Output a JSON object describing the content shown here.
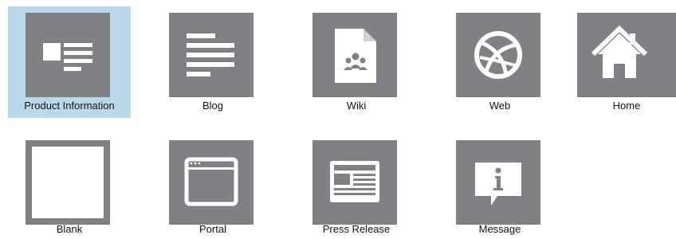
{
  "templates": [
    {
      "label": "Product Information",
      "icon": "product-information-icon",
      "selected": true
    },
    {
      "label": "Blog",
      "icon": "blog-icon",
      "selected": false
    },
    {
      "label": "Wiki",
      "icon": "wiki-icon",
      "selected": false
    },
    {
      "label": "Web",
      "icon": "web-icon",
      "selected": false
    },
    {
      "label": "Home",
      "icon": "home-icon",
      "selected": false
    },
    {
      "label": "Blank",
      "icon": "blank-icon",
      "selected": false
    },
    {
      "label": "Portal",
      "icon": "portal-icon",
      "selected": false
    },
    {
      "label": "Press Release",
      "icon": "press-release-icon",
      "selected": false
    },
    {
      "label": "Message",
      "icon": "message-icon",
      "selected": false
    }
  ],
  "colors": {
    "tile_background": "#7f8184",
    "icon_foreground": "#ffffff",
    "selection_highlight": "#b9d9ea"
  }
}
